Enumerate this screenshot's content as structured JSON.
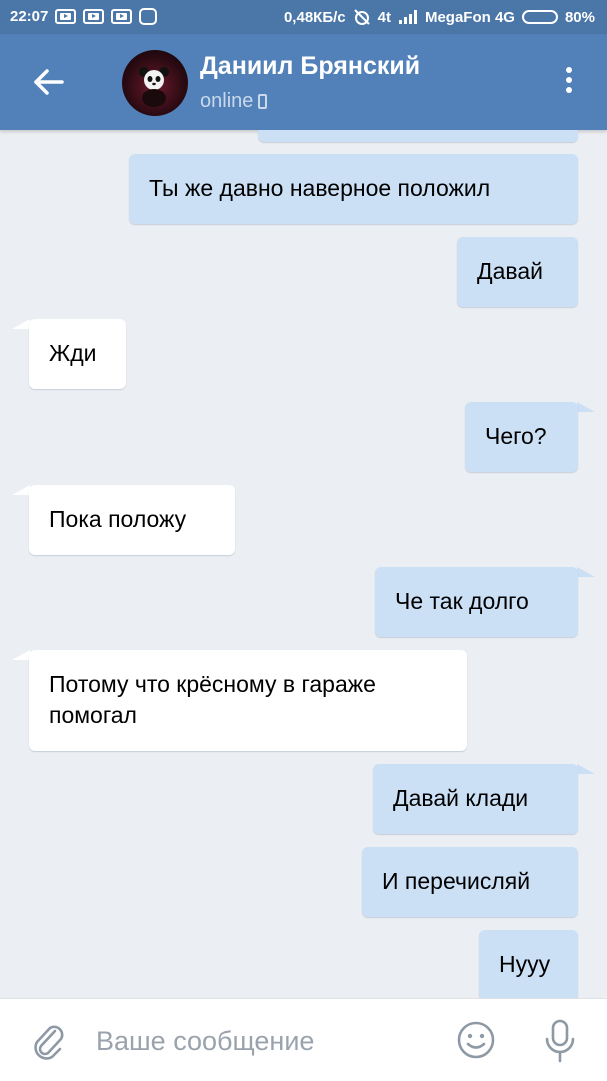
{
  "status_bar": {
    "time": "22:07",
    "net_speed": "0,48КБ/с",
    "signal_text": "4t",
    "carrier": "MegaFon 4G",
    "battery": "80%",
    "battery_level": 0.8
  },
  "header": {
    "contact_name": "Даниил Брянский",
    "contact_status": "online",
    "back_icon": "arrow-left-icon",
    "menu_icon": "more-vertical-icon"
  },
  "messages": [
    {
      "direction": "out",
      "text": "Ты же давно наверное положил"
    },
    {
      "direction": "out",
      "text": "Давай"
    },
    {
      "direction": "in",
      "text": "Жди"
    },
    {
      "direction": "out",
      "text": "Чего?"
    },
    {
      "direction": "in",
      "text": "Пока положу"
    },
    {
      "direction": "out",
      "text": "Че так долго"
    },
    {
      "direction": "in",
      "text": "Потому что крёсному в гараже помогал"
    },
    {
      "direction": "out",
      "text": "Давай клади"
    },
    {
      "direction": "out",
      "text": "И перечисляй"
    },
    {
      "direction": "out",
      "text": "Нууу"
    }
  ],
  "composer": {
    "placeholder": "Ваше сообщение",
    "attach_icon": "paperclip-icon",
    "emoji_icon": "smile-icon",
    "mic_icon": "microphone-icon"
  },
  "colors": {
    "header": "#5181b8",
    "status_bar": "#4a76a8",
    "chat_background": "#ebeef2",
    "outgoing_bubble": "#cce0f5",
    "incoming_bubble": "#ffffff"
  }
}
